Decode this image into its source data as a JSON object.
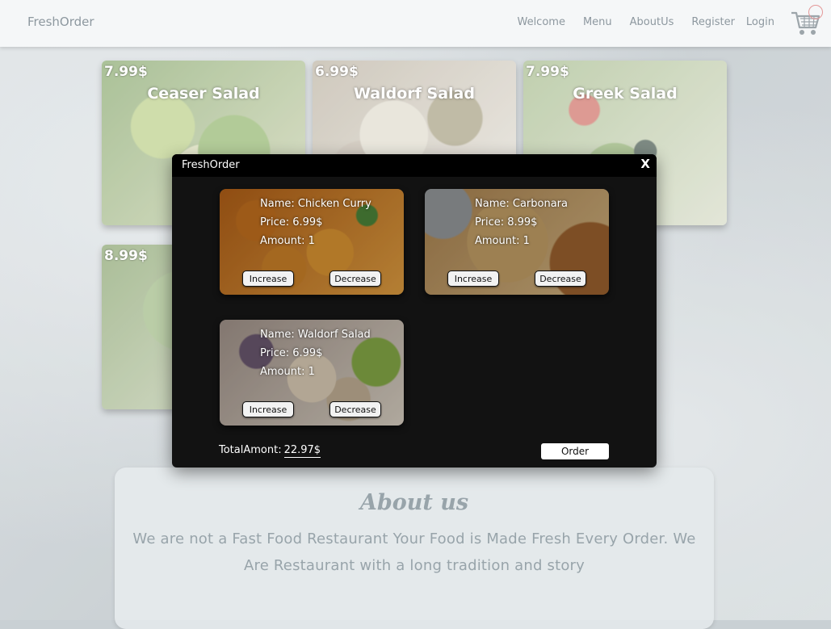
{
  "navbar": {
    "brand": "FreshOrder",
    "links": [
      "Welcome",
      "Menu",
      "AboutUs",
      "Register",
      "Login"
    ],
    "cart_icon": "shopping-cart-icon"
  },
  "menu": {
    "cards": [
      {
        "price": "7.99$",
        "title": "Ceaser Salad"
      },
      {
        "price": "6.99$",
        "title": "Waldorf Salad"
      },
      {
        "price": "7.99$",
        "title": "Greek Salad"
      },
      {
        "price": "8.99$",
        "title": ""
      }
    ]
  },
  "about": {
    "title": "About us",
    "text": "We are not a Fast Food Restaurant Your Food is Made Fresh Every Order. We Are Restaurant with a long tradition and story"
  },
  "modal": {
    "title": "FreshOrder",
    "close_label": "X",
    "items": [
      {
        "name": "Name: Chicken Curry",
        "price": "Price: 6.99$",
        "amount": "Amount: 1"
      },
      {
        "name": "Name: Carbonara",
        "price": "Price: 8.99$",
        "amount": "Amount: 1"
      },
      {
        "name": "Name: Waldorf Salad",
        "price": "Price: 6.99$",
        "amount": "Amount: 1"
      }
    ],
    "increase_label": "Increase",
    "decrease_label": "Decrease",
    "total_label": "TotalAmont:",
    "total_value": "22.97$",
    "order_label": "Order"
  }
}
